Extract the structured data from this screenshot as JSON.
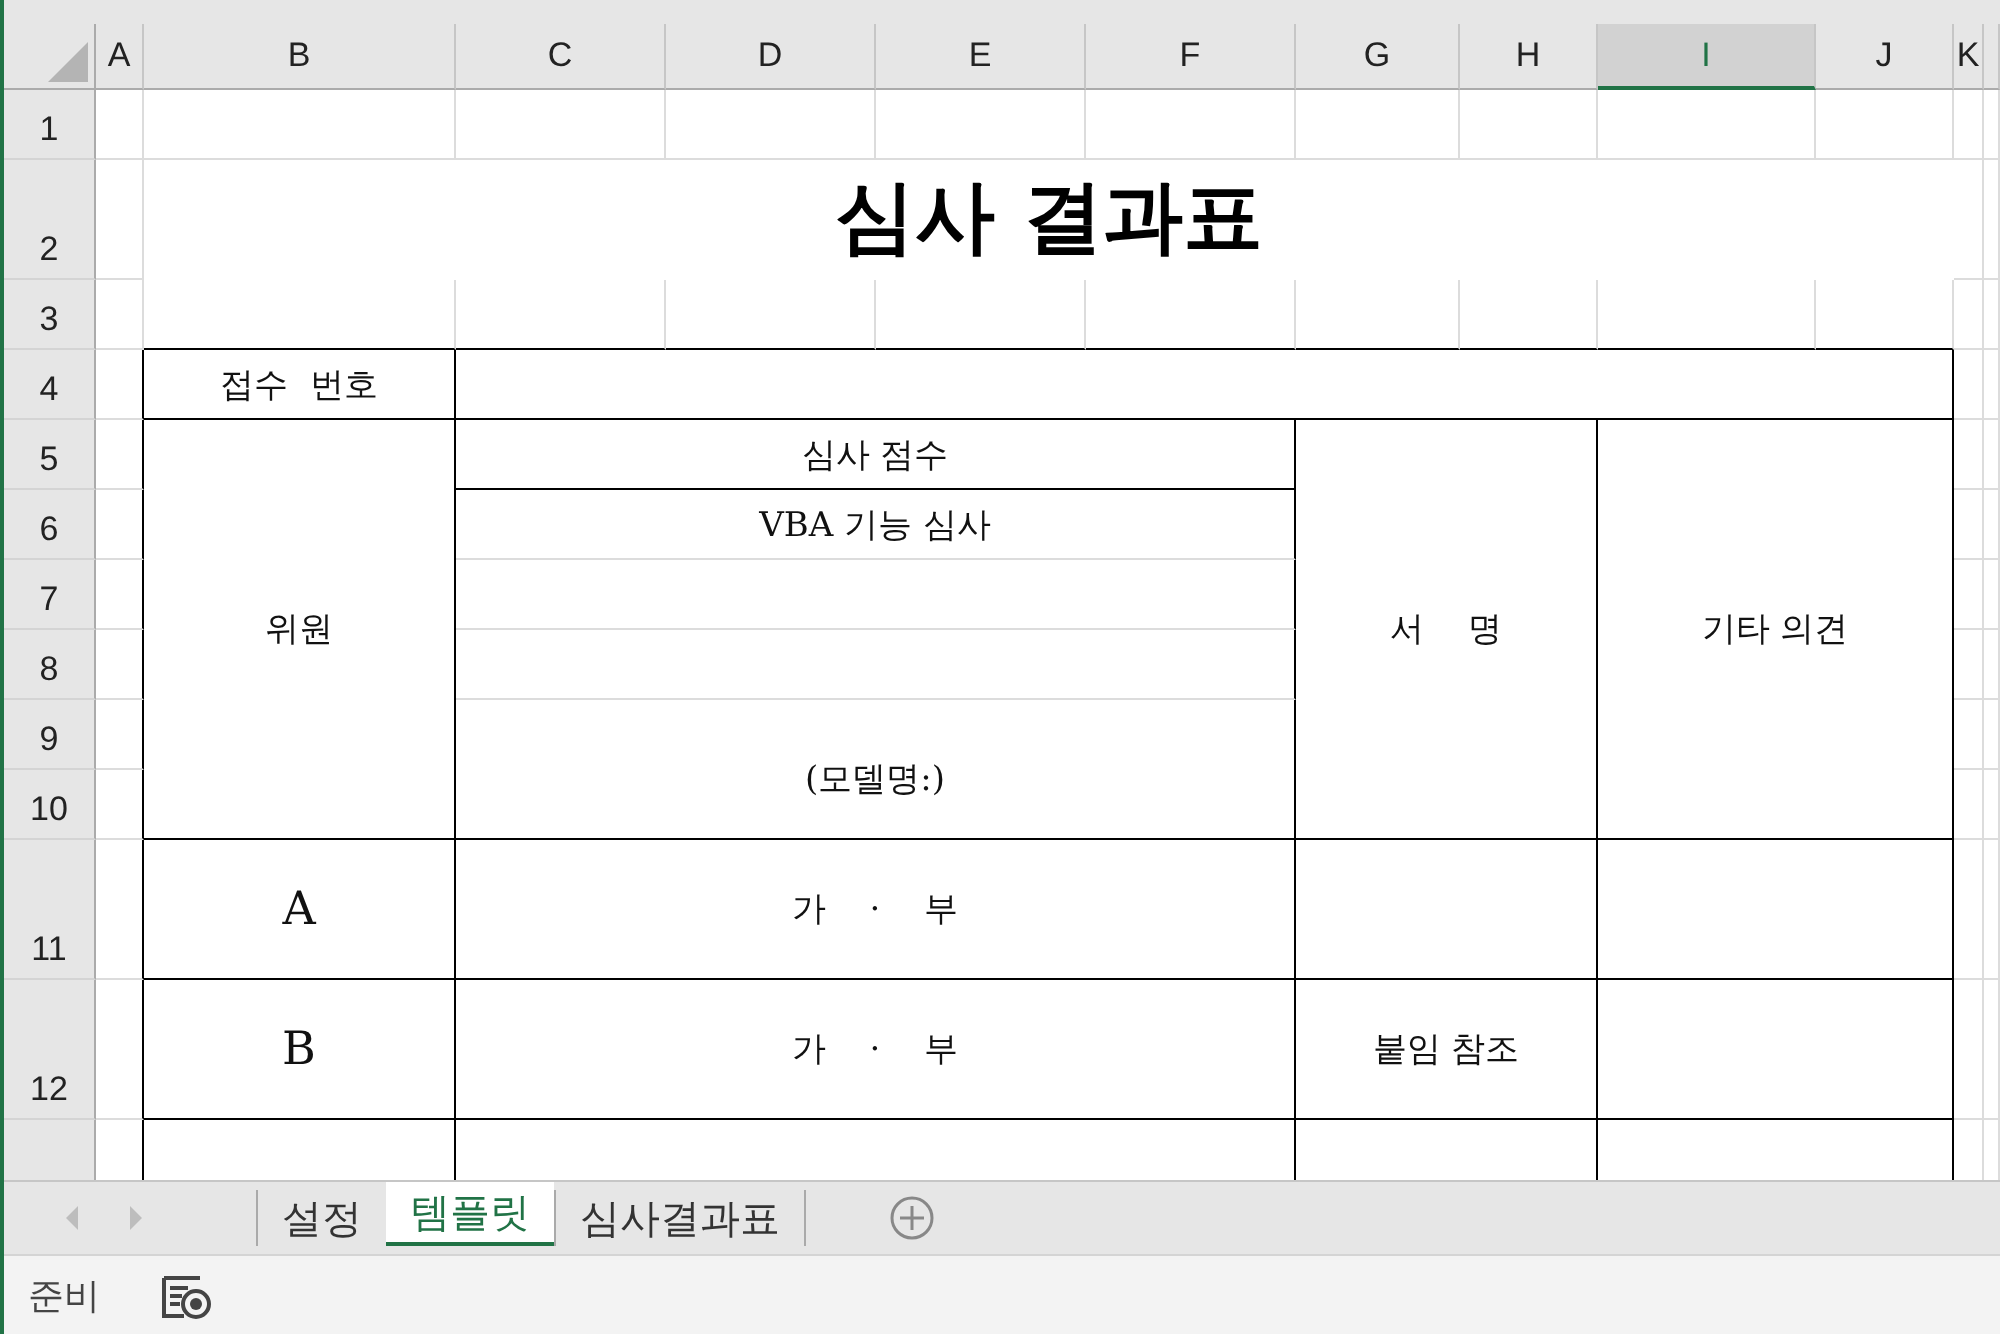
{
  "column_headers": [
    {
      "label": "A",
      "selected": false
    },
    {
      "label": "B",
      "selected": false
    },
    {
      "label": "C",
      "selected": false
    },
    {
      "label": "D",
      "selected": false
    },
    {
      "label": "E",
      "selected": false
    },
    {
      "label": "F",
      "selected": false
    },
    {
      "label": "G",
      "selected": false
    },
    {
      "label": "H",
      "selected": false
    },
    {
      "label": "I",
      "selected": true
    },
    {
      "label": "J",
      "selected": false
    },
    {
      "label": "K",
      "selected": false
    }
  ],
  "row_headers": [
    "1",
    "2",
    "3",
    "4",
    "5",
    "6",
    "7",
    "8",
    "9",
    "10",
    "11",
    "12"
  ],
  "title": "심사 결과표",
  "form": {
    "receipt_label": "접수  번호",
    "member_label": "위원",
    "score_label": "심사 점수",
    "review_label": "VBA 기능 심사",
    "model_label": "(모델명:)",
    "signature_label": "서    명",
    "comment_label": "기타 의견",
    "rows": [
      {
        "member": "A",
        "result": "가    ·    부"
      },
      {
        "member": "B",
        "result": "가    ·    부",
        "signature": "붙임 참조"
      }
    ]
  },
  "sheet_tabs": [
    {
      "label": "설정",
      "selected": false
    },
    {
      "label": "템플릿",
      "selected": true
    },
    {
      "label": "심사결과표",
      "selected": false
    }
  ],
  "status_bar": {
    "text": "준비"
  }
}
